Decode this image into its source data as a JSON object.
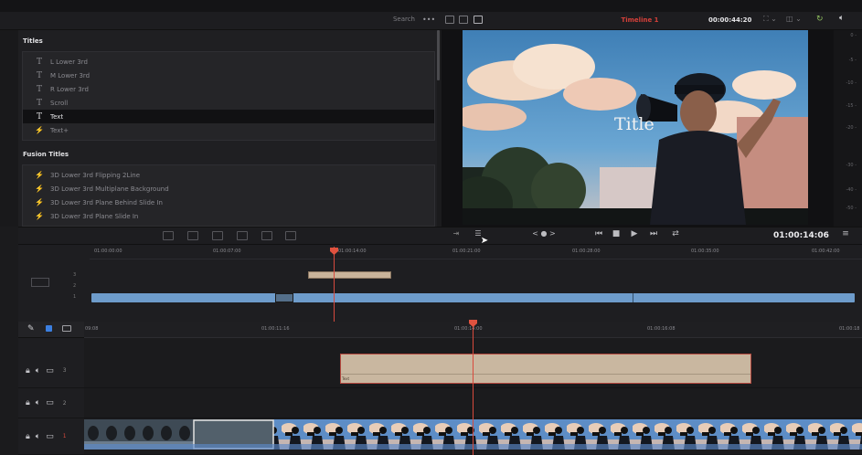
{
  "header": {
    "search_placeholder": "Search",
    "timeline_name": "Timeline 1",
    "timecode": "00:00:44:20",
    "ellipsis": "•••"
  },
  "effects": {
    "titles_heading": "Titles",
    "titles": [
      {
        "label": "L Lower 3rd",
        "icon": "T"
      },
      {
        "label": "M Lower 3rd",
        "icon": "T"
      },
      {
        "label": "R Lower 3rd",
        "icon": "T"
      },
      {
        "label": "Scroll",
        "icon": "T"
      },
      {
        "label": "Text",
        "icon": "T",
        "selected": true
      },
      {
        "label": "Text+",
        "icon": "⚡"
      }
    ],
    "fusion_heading": "Fusion Titles",
    "fusion_titles": [
      {
        "label": "3D Lower 3rd Flipping 2Line",
        "icon": "⚡"
      },
      {
        "label": "3D Lower 3rd Multiplane Background",
        "icon": "⚡"
      },
      {
        "label": "3D Lower 3rd Plane Behind Slide In",
        "icon": "⚡"
      },
      {
        "label": "3D Lower 3rd Plane Slide In",
        "icon": "⚡"
      }
    ]
  },
  "viewer": {
    "title_overlay": "Title",
    "timecode": "01:00:14:06",
    "meter_ticks": [
      "0 -",
      "-5 -",
      "-10 -",
      "-15 -",
      "-20 -",
      "-30 -",
      "-40 -",
      "-50 -"
    ]
  },
  "transport": {
    "jog": "< ● >",
    "prev": "⏮",
    "stop": "■",
    "play": "▶",
    "next": "⏭",
    "loop": "⇄",
    "menu": "≡"
  },
  "mini_timeline": {
    "ruler": [
      "01:00:00:00",
      "01:00:07:00",
      "01:00:14:00",
      "01:00:21:00",
      "01:00:28:00",
      "01:00:35:00",
      "01:00:42:00"
    ],
    "track_numbers": [
      "3",
      "2",
      "1"
    ]
  },
  "timeline": {
    "ruler": [
      "09:08",
      "01:00:11:16",
      "01:00:14:00",
      "01:00:16:08",
      "01:00:18"
    ],
    "tracks": [
      {
        "number": "3"
      },
      {
        "number": "2"
      },
      {
        "number": "1"
      }
    ],
    "title_clip_label": "Text"
  },
  "colors": {
    "accent_red": "#d84a3c",
    "title_clip": "#c9b7a0",
    "video_clip_blue": "#6e9ccb"
  }
}
